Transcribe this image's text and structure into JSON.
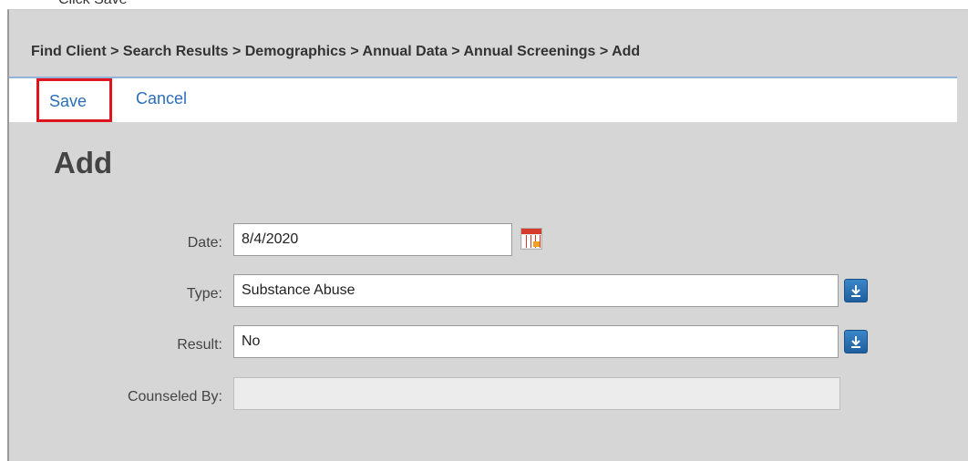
{
  "instruction": "Click Save",
  "breadcrumb": {
    "text": "Find Client > Search Results > Demographics > Annual Data > Annual Screenings > Add"
  },
  "actions": {
    "save_label": "Save",
    "cancel_label": "Cancel"
  },
  "page": {
    "title": "Add"
  },
  "form": {
    "date": {
      "label": "Date:",
      "value": "8/4/2020",
      "icon": "calendar-icon"
    },
    "type": {
      "label": "Type:",
      "value": "Substance Abuse",
      "icon": "dropdown-arrow-icon"
    },
    "result": {
      "label": "Result:",
      "value": "No",
      "icon": "dropdown-arrow-icon"
    },
    "counseled_by": {
      "label": "Counseled By:",
      "value": ""
    }
  },
  "colors": {
    "link": "#2a6ebb",
    "highlight": "#e0141e",
    "panel_bg": "#d6d6d6",
    "dropdown_button": "#2a78c0"
  }
}
